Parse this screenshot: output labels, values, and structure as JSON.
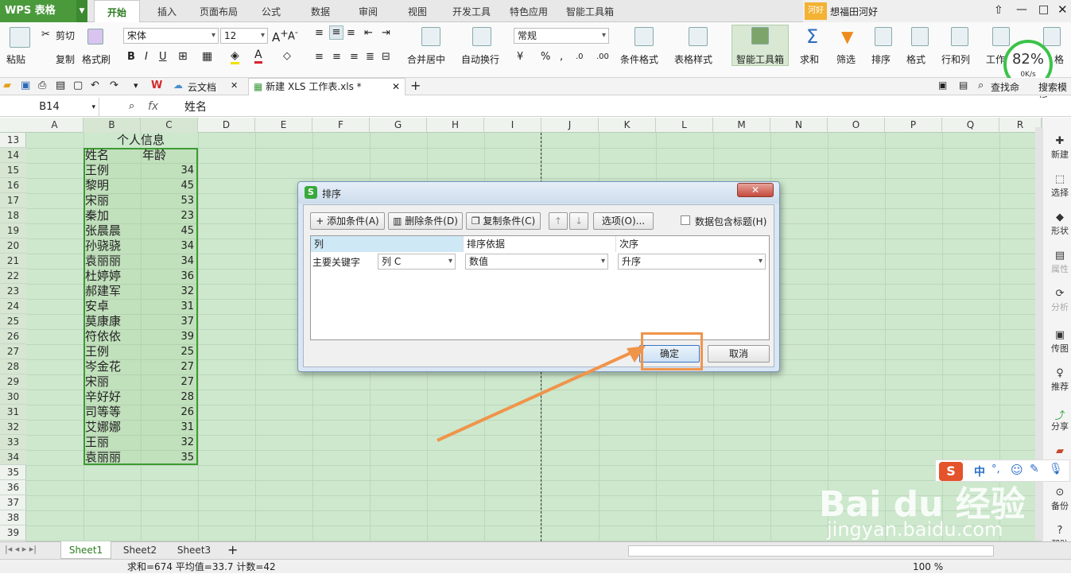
{
  "app": {
    "name": "WPS 表格",
    "user": "想福田河好",
    "badge": "河好"
  },
  "tabs": [
    "开始",
    "插入",
    "页面布局",
    "公式",
    "数据",
    "审阅",
    "视图",
    "开发工具",
    "特色应用",
    "智能工具箱"
  ],
  "ribbon": {
    "paste": "粘贴",
    "cut": "剪切",
    "copy": "复制",
    "format_painter": "格式刷",
    "font": "宋体",
    "size": "12",
    "merge": "合并居中",
    "wrap": "自动换行",
    "numfmt": "常规",
    "cond_fmt": "条件格式",
    "table_style": "表格样式",
    "smart_tools": "智能工具箱",
    "sum": "求和",
    "filter": "筛选",
    "sort": "排序",
    "format": "格式",
    "rowcol": "行和列",
    "worksheet": "工作",
    "grid_label": "格"
  },
  "speed": {
    "percent": "82%",
    "rate": "0K/s"
  },
  "quick": {
    "cloud": "云文档",
    "doc": "新建 XLS 工作表.xls *",
    "find": "查找命",
    "search_tpl": "搜索模板"
  },
  "formula": {
    "cell": "B14",
    "fx": "fx",
    "value": "姓名"
  },
  "columns": [
    "A",
    "B",
    "C",
    "D",
    "E",
    "F",
    "G",
    "H",
    "I",
    "J",
    "K",
    "L",
    "M",
    "N",
    "O",
    "P",
    "Q",
    "R"
  ],
  "rows": [
    "13",
    "14",
    "15",
    "16",
    "17",
    "18",
    "19",
    "20",
    "21",
    "22",
    "23",
    "24",
    "25",
    "26",
    "27",
    "28",
    "29",
    "30",
    "31",
    "32",
    "33",
    "34",
    "35",
    "36",
    "37",
    "38",
    "39"
  ],
  "table": {
    "title": "个人信息",
    "header": [
      "姓名",
      "年龄"
    ],
    "records": [
      [
        "王例",
        "34"
      ],
      [
        "黎明",
        "45"
      ],
      [
        "宋丽",
        "53"
      ],
      [
        "秦加",
        "23"
      ],
      [
        "张晨晨",
        "45"
      ],
      [
        "孙骁骁",
        "34"
      ],
      [
        "袁丽丽",
        "34"
      ],
      [
        "杜婷婷",
        "36"
      ],
      [
        "郝建军",
        "32"
      ],
      [
        "安卓",
        "31"
      ],
      [
        "莫康康",
        "37"
      ],
      [
        "符依依",
        "39"
      ],
      [
        "王例",
        "25"
      ],
      [
        "岑金花",
        "27"
      ],
      [
        "宋丽",
        "27"
      ],
      [
        "辛好好",
        "28"
      ],
      [
        "司等等",
        "26"
      ],
      [
        "艾娜娜",
        "31"
      ],
      [
        "王丽",
        "32"
      ],
      [
        "袁丽丽",
        "35"
      ]
    ]
  },
  "side_panel": [
    "新建",
    "选择",
    "形状",
    "属性",
    "分析",
    "传图",
    "推荐",
    "分享",
    "",
    "备份",
    "帮助"
  ],
  "sheets": [
    "Sheet1",
    "Sheet2",
    "Sheet3"
  ],
  "status": {
    "stats": "求和=674  平均值=33.7  计数=42",
    "zoom": "100 %"
  },
  "dialog": {
    "title": "排序",
    "add": "添加条件(A)",
    "delete": "删除条件(D)",
    "copy": "复制条件(C)",
    "options": "选项(O)...",
    "header_check": "数据包含标题(H)",
    "col_header": "列",
    "basis_header": "排序依据",
    "order_header": "次序",
    "key_label": "主要关键字",
    "key_value": "列 C",
    "basis_value": "数值",
    "order_value": "升序",
    "ok": "确定",
    "cancel": "取消"
  },
  "ime": {
    "label": "中"
  },
  "watermark": {
    "brand": "Bai du 经验",
    "url": "jingyan.baidu.com"
  },
  "colors": {
    "accent": "#4a9a3c",
    "grid_bg": "#cde8cd",
    "highlight": "#f0944a"
  }
}
